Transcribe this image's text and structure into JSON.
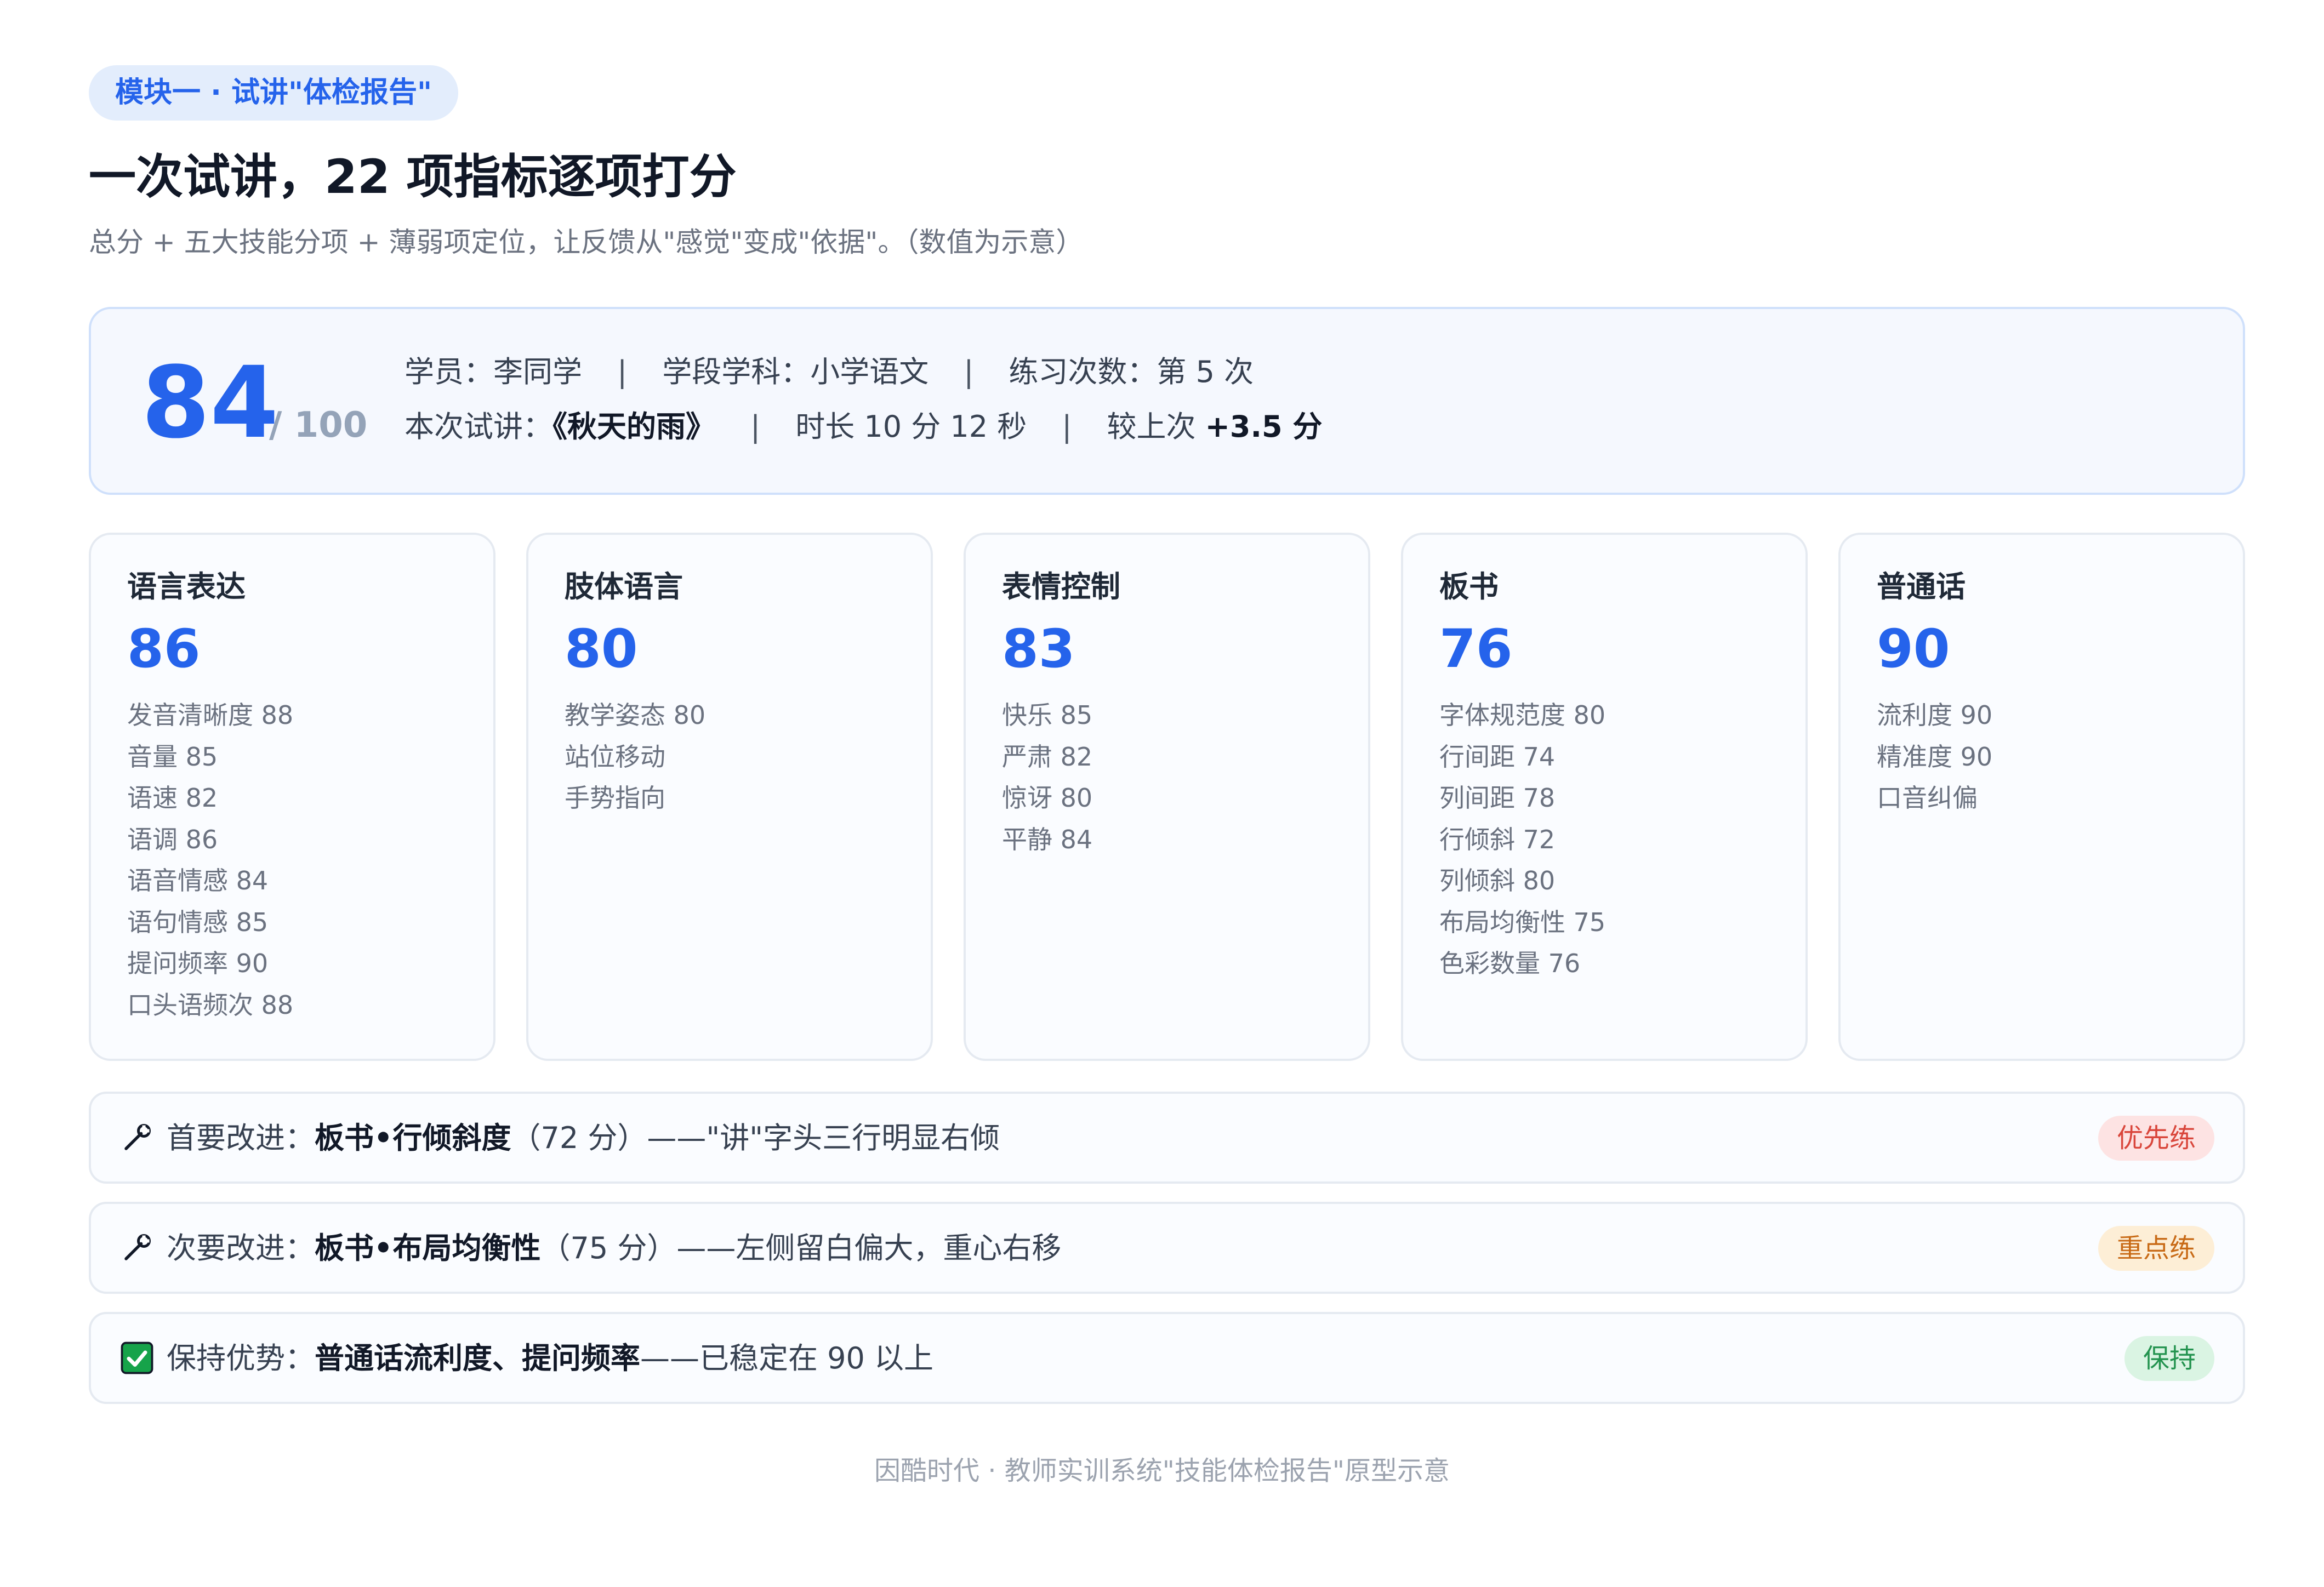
{
  "header": {
    "module_pill": "模块一 · 试讲\"体检报告\"",
    "title": "一次试讲，22 项指标逐项打分",
    "subtitle": "总分 + 五大技能分项 + 薄弱项定位，让反馈从\"感觉\"变成\"依据\"。（数值为示意）"
  },
  "summary": {
    "total_score": "84",
    "max_score": "/ 100",
    "student_label": "学员：",
    "student_name": "李同学",
    "subject_label": "学段学科：",
    "subject_value": "小学语文",
    "practice_label": "练习次数：",
    "practice_value": "第 5 次",
    "lesson_label": "本次试讲：",
    "lesson_title": "《秋天的雨》",
    "duration": "时长 10 分 12 秒",
    "compare_label": "较上次",
    "compare_value": "+3.5 分",
    "separator": "|"
  },
  "skills": [
    {
      "name": "语言表达",
      "score": "86",
      "items": [
        "发音清晰度 88",
        "音量 85",
        "语速 82",
        "语调 86",
        "语音情感 84",
        "语句情感 85",
        "提问频率 90",
        "口头语频次 88"
      ]
    },
    {
      "name": "肢体语言",
      "score": "80",
      "items": [
        "教学姿态 80",
        "站位移动",
        "手势指向"
      ]
    },
    {
      "name": "表情控制",
      "score": "83",
      "items": [
        "快乐 85",
        "严肃 82",
        "惊讶 80",
        "平静 84"
      ]
    },
    {
      "name": "板书",
      "score": "76",
      "items": [
        "字体规范度 80",
        "行间距 74",
        "列间距 78",
        "行倾斜 72",
        "列倾斜 80",
        "布局均衡性 75",
        "色彩数量 76"
      ]
    },
    {
      "name": "普通话",
      "score": "90",
      "items": [
        "流利度 90",
        "精准度 90",
        "口音纠偏"
      ]
    }
  ],
  "improvements": [
    {
      "icon": "wrench-icon",
      "label": "首要改进：",
      "focus": "板书•行倾斜度",
      "detail": "（72 分）——\"讲\"字头三行明显右倾",
      "badge": "优先练",
      "badge_color": "#d9463b"
    },
    {
      "icon": "wrench-icon",
      "label": "次要改进：",
      "focus": "板书•布局均衡性",
      "detail": "（75 分）——左侧留白偏大，重心右移",
      "badge": "重点练",
      "badge_color": "#c86a16"
    },
    {
      "icon": "check-icon",
      "label": "保持优势：",
      "focus": "普通话流利度、提问频率",
      "detail": "——已稳定在 90 以上",
      "badge": "保持",
      "badge_color": "#23934f"
    }
  ],
  "footer": "因酷时代 · 教师实训系统\"技能体检报告\"原型示意"
}
